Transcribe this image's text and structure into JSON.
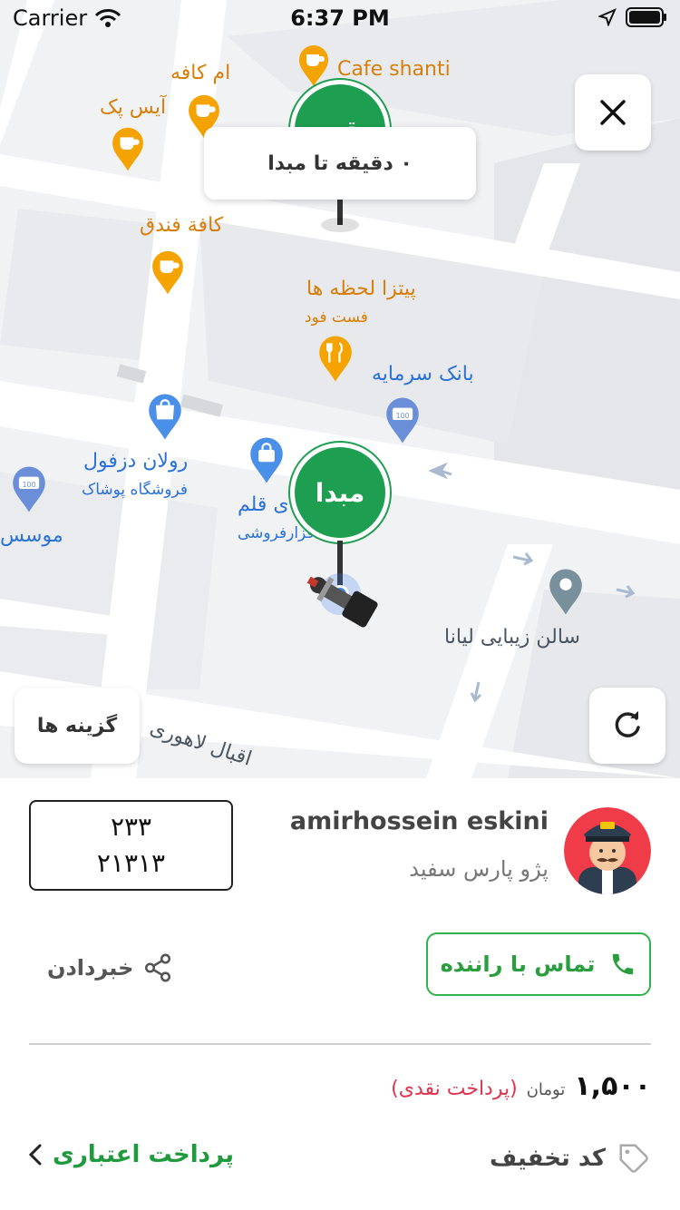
{
  "status_bar": {
    "carrier": "Carrier",
    "time": "6:37 PM"
  },
  "map": {
    "tooltip": "۰ دقیقه تا مبدا",
    "origin_marker": "مبدا",
    "top_marker": "مقصد",
    "options_button": "گزینه ها",
    "pois": {
      "cafe_shanti": "Cafe shanti",
      "am_cafe": "ام کافه",
      "ice_pack": "آیس پک",
      "cafe_fandogh": "کافة فندق",
      "pizza": "پیتزا لحظه ها",
      "pizza_sub": "فست فود",
      "bank": "بانک سرمایه",
      "rolan": "رولان دزفول",
      "rolan_sub": "فروشگاه پوشاک",
      "neveshtafzar": "نوشت   ی قلم",
      "neveshtafzar_sub": "فو   افزارفروشی",
      "moasese": "موسس",
      "salon": "سالن زیبایی لیانا",
      "street": "اقبال لاهوری"
    }
  },
  "driver": {
    "plate_top": "۲۳۳",
    "plate_bottom": "۲۱۳۱۳",
    "name": "amirhossein eskini",
    "car": "پژو پارس سفید"
  },
  "actions": {
    "call": "تماس با راننده",
    "share": "خبردادن"
  },
  "payment": {
    "amount": "۱,۵۰۰",
    "unit": "تومان",
    "method": "(پرداخت نقدی)",
    "discount": "کد تخفیف",
    "credit": "پرداخت اعتباری"
  },
  "colors": {
    "accent_green": "#2db34a",
    "origin_green": "#1e9e50",
    "price_red": "#e0334e",
    "poi_orange": "#f5a300",
    "poi_blue": "#4a8fe8"
  }
}
